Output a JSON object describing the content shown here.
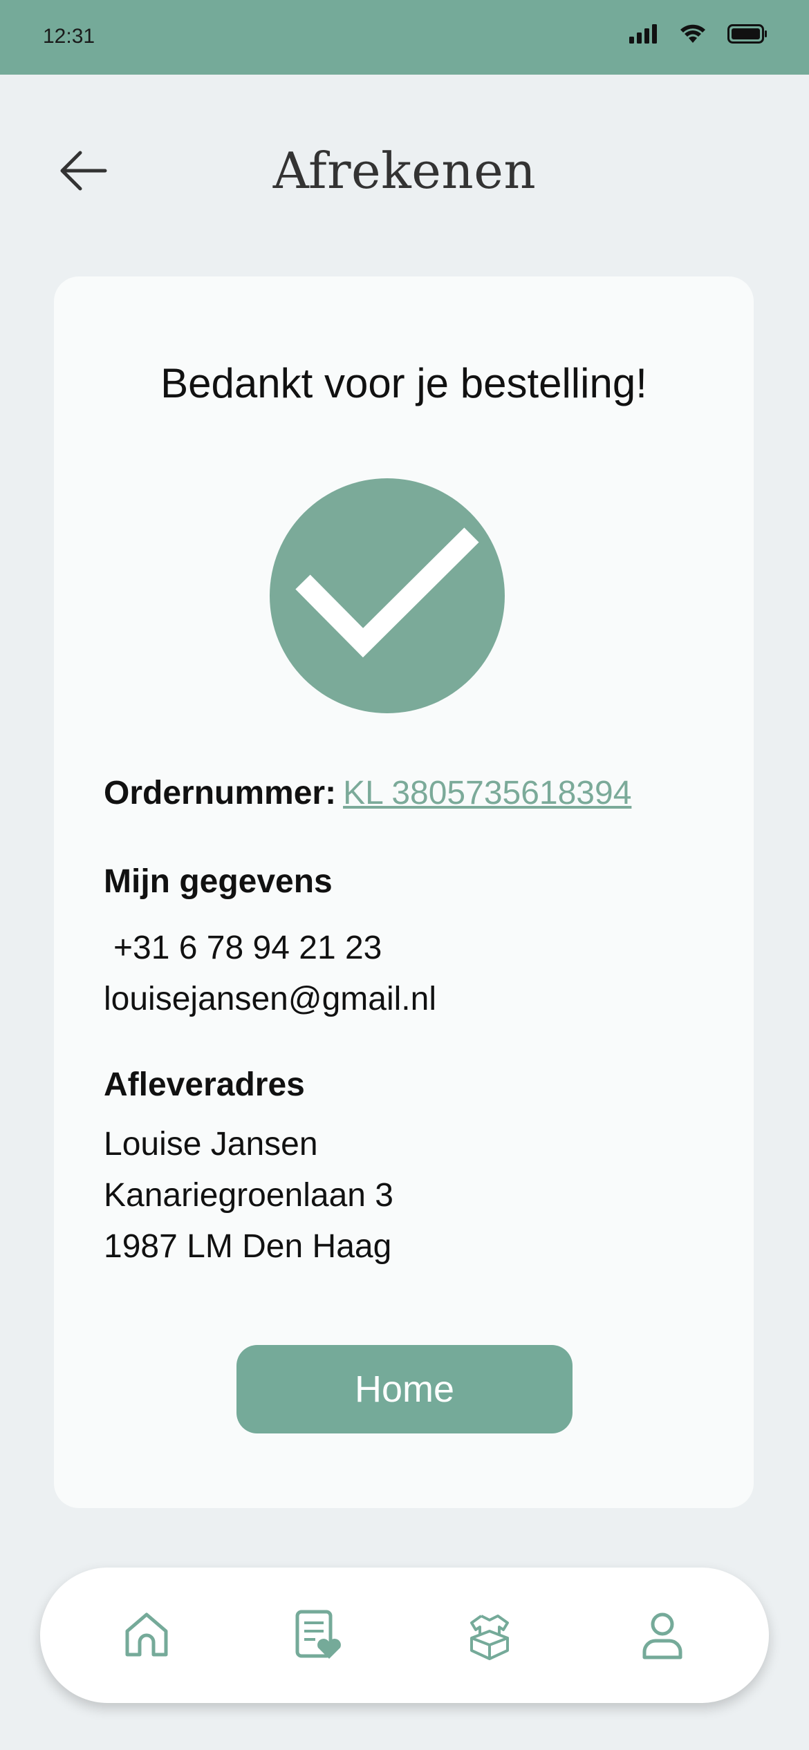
{
  "status_bar": {
    "time": "12:31",
    "icons": [
      "cellular-signal-icon",
      "wifi-icon",
      "battery-icon"
    ]
  },
  "header": {
    "title": "Afrekenen",
    "back_icon": "arrow-left-icon"
  },
  "confirmation": {
    "heading": "Bedankt voor je bestelling!",
    "icon": "check-circle-icon",
    "order_label": "Ordernummer:",
    "order_number": "KL 3805735618394"
  },
  "details": {
    "title": "Mijn gegevens",
    "phone": "+31 6 78 94 21 23",
    "email": "louisejansen@gmail.nl"
  },
  "address": {
    "title": "Afleveradres",
    "name": "Louise Jansen",
    "street": "Kanariegroenlaan 3",
    "city": "1987 LM Den Haag"
  },
  "home_button": {
    "label": "Home"
  },
  "bottom_nav": {
    "items": [
      {
        "icon": "home-icon"
      },
      {
        "icon": "wishlist-icon"
      },
      {
        "icon": "box-icon"
      },
      {
        "icon": "user-icon"
      }
    ]
  },
  "colors": {
    "accent": "#75AA99",
    "accent_light": "#7BAA99",
    "background": "#ECF0F2",
    "card": "#F9FBFB"
  }
}
